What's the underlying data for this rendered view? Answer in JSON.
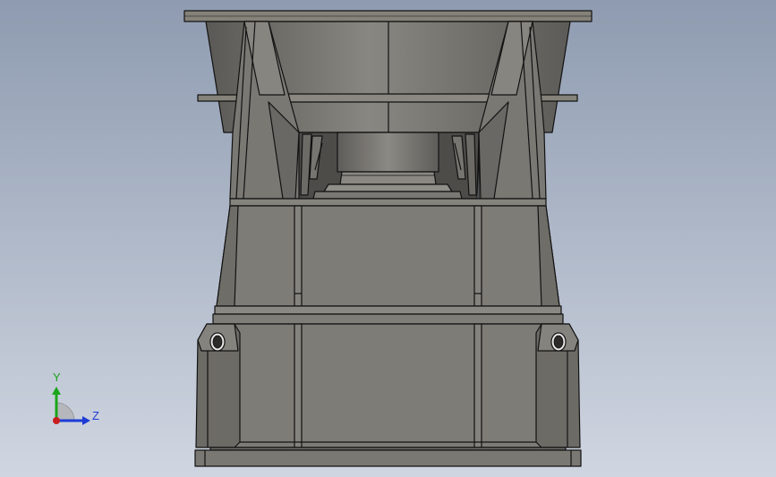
{
  "viewport": {
    "background_top": "#8e9bb0",
    "background_bottom": "#d0d6e1"
  },
  "model": {
    "name": "steel-frame-housing",
    "fill_color": "#7d7b76",
    "fill_dark": "#5f5d59",
    "fill_light": "#8a8882",
    "edge_color": "#121212"
  },
  "triad": {
    "y_label": "Y",
    "z_label": "Z",
    "y_color": "#1aa51a",
    "z_color": "#1e3bd6",
    "x_color": "#c81e1e"
  }
}
